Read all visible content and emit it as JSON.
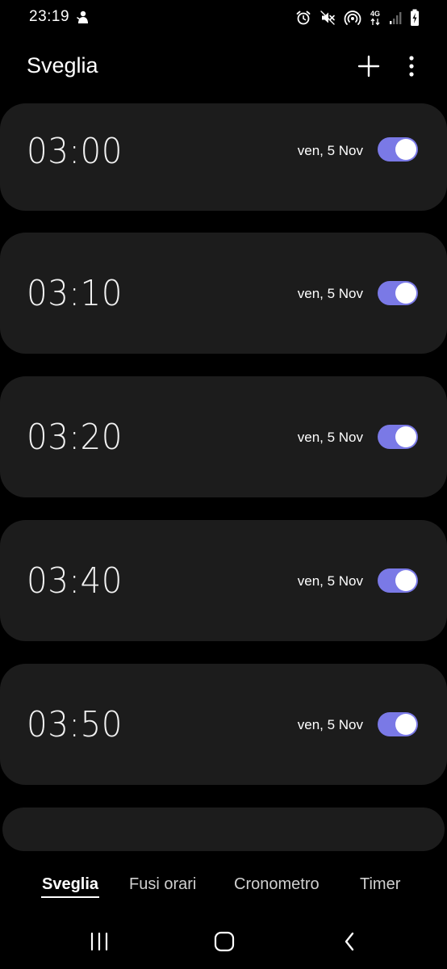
{
  "status_bar": {
    "time": "23:19",
    "network_type": "4G",
    "left_icon": "notification-app-icon",
    "right_icons": [
      "alarm-icon",
      "mute-icon",
      "hotspot-icon",
      "network-arrows-icon",
      "signal-icon",
      "battery-icon"
    ]
  },
  "header": {
    "title": "Sveglia",
    "add_icon": "plus-icon",
    "more_icon": "more-vertical-icon"
  },
  "alarms": [
    {
      "time": "03:00",
      "date": "ven, 5 Nov",
      "enabled": true
    },
    {
      "time": "03:10",
      "date": "ven, 5 Nov",
      "enabled": true
    },
    {
      "time": "03:20",
      "date": "ven, 5 Nov",
      "enabled": true
    },
    {
      "time": "03:40",
      "date": "ven, 5 Nov",
      "enabled": true
    },
    {
      "time": "03:50",
      "date": "ven, 5 Nov",
      "enabled": true
    }
  ],
  "tabs": [
    {
      "label": "Sveglia",
      "active": true
    },
    {
      "label": "Fusi orari",
      "active": false
    },
    {
      "label": "Cronometro",
      "active": false
    },
    {
      "label": "Timer",
      "active": false
    }
  ],
  "nav": {
    "recents_icon": "recent-apps-icon",
    "home_icon": "home-icon",
    "back_icon": "back-icon"
  },
  "colors": {
    "background": "#000000",
    "card": "#1c1c1c",
    "toggle_on": "#7a79e6",
    "text": "#ffffff"
  }
}
